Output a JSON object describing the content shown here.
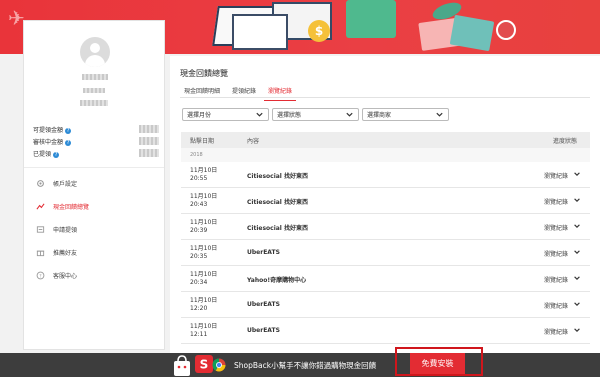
{
  "sidebar": {
    "balances": [
      {
        "label": "可提領金額"
      },
      {
        "label": "審核中金額"
      },
      {
        "label": "已提領"
      }
    ],
    "nav": [
      {
        "label": "帳戶設定",
        "icon": "gear-icon"
      },
      {
        "label": "現金回饋總覽",
        "icon": "chart-icon"
      },
      {
        "label": "申請提領",
        "icon": "withdraw-icon"
      },
      {
        "label": "推薦好友",
        "icon": "gift-icon"
      },
      {
        "label": "客服中心",
        "icon": "question-icon"
      }
    ]
  },
  "main": {
    "title": "現金回饋總覽",
    "tabs": [
      "現金回饋明細",
      "提領紀錄",
      "瀏覽紀錄"
    ],
    "active_tab": 2,
    "filters": [
      "選擇月份",
      "選擇狀態",
      "選擇商家"
    ],
    "table": {
      "headers": {
        "date": "點擊日期",
        "content": "內容",
        "status": "進度狀態"
      },
      "year": "2018",
      "rows": [
        {
          "date": "11月10日",
          "time": "20:55",
          "store": "Citiesocial 找好東西",
          "status": "瀏覽紀錄"
        },
        {
          "date": "11月10日",
          "time": "20:43",
          "store": "Citiesocial 找好東西",
          "status": "瀏覽紀錄"
        },
        {
          "date": "11月10日",
          "time": "20:39",
          "store": "Citiesocial 找好東西",
          "status": "瀏覽紀錄"
        },
        {
          "date": "11月10日",
          "time": "20:35",
          "store": "UberEATS",
          "status": "瀏覽紀錄"
        },
        {
          "date": "11月10日",
          "time": "20:34",
          "store": "Yahoo!奇摩購物中心",
          "status": "瀏覽紀錄"
        },
        {
          "date": "11月10日",
          "time": "12:20",
          "store": "UberEATS",
          "status": "瀏覽紀錄"
        },
        {
          "date": "11月10日",
          "time": "12:11",
          "store": "UberEATS",
          "status": "瀏覽紀錄"
        }
      ]
    }
  },
  "promo": {
    "text": "ShopBack小幫手不讓你錯過購物現金回饋",
    "button": "免費安裝"
  },
  "colors": {
    "accent": "#e32c33",
    "banner": "#e9343a",
    "promo_bg": "#3d3d3d"
  }
}
